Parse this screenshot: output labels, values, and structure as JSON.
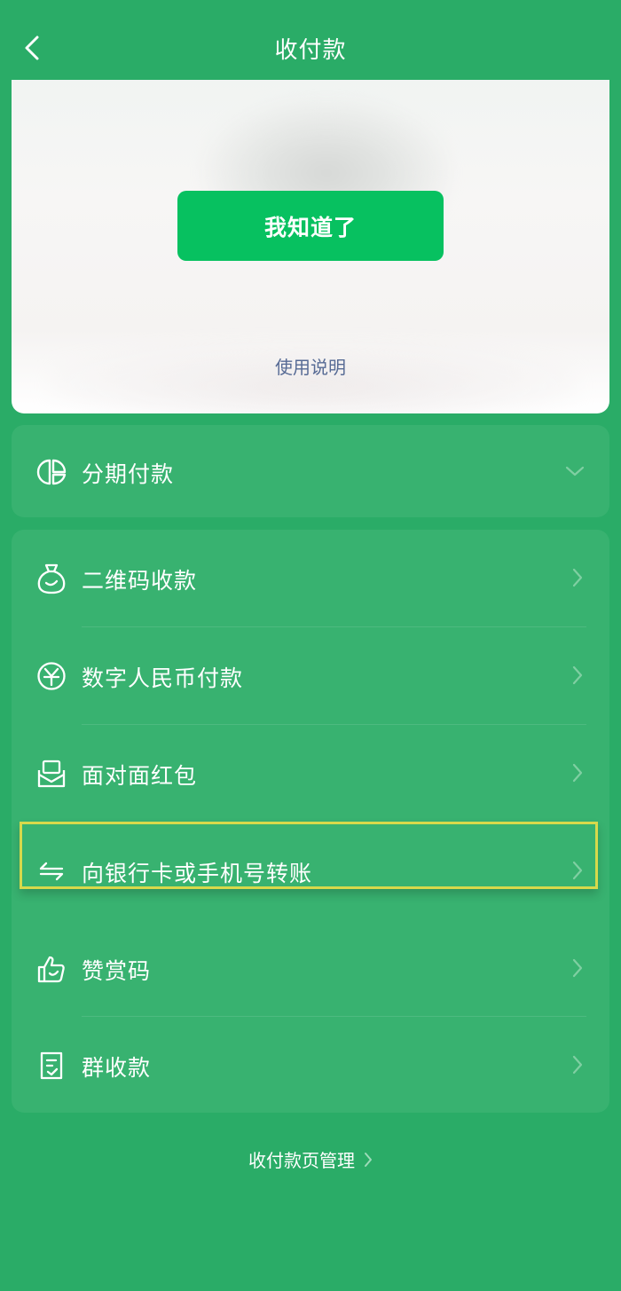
{
  "header": {
    "title": "收付款"
  },
  "notice": {
    "ack_button": "我知道了",
    "usage_link": "使用说明"
  },
  "installment": {
    "label": "分期付款",
    "icon": "pie-chart-icon"
  },
  "menu": {
    "items": [
      {
        "label": "二维码收款",
        "icon": "money-bag-icon"
      },
      {
        "label": "数字人民币付款",
        "icon": "digital-yuan-icon"
      },
      {
        "label": "面对面红包",
        "icon": "red-packet-icon"
      },
      {
        "label": "向银行卡或手机号转账",
        "icon": "transfer-arrows-icon"
      },
      {
        "label": "赞赏码",
        "icon": "thumbs-up-icon"
      },
      {
        "label": "群收款",
        "icon": "group-receipt-icon"
      }
    ]
  },
  "footer": {
    "manage_link": "收付款页管理"
  },
  "colors": {
    "background": "#2aac67",
    "card": "#38b270",
    "primary_button": "#07c160",
    "link": "#576b95",
    "highlight_border": "#d7d94b"
  }
}
